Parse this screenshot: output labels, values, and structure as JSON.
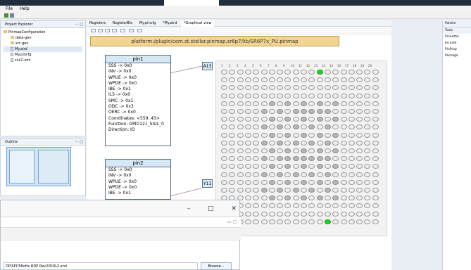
{
  "window": {
    "menu": [
      "File",
      "Help"
    ]
  },
  "left_panel": {
    "title": "Project Explorer",
    "tree": {
      "root": "PinmapConfiguration",
      "children": [
        "data-gen",
        "src-gen",
        "My.aird",
        "My.pincfg",
        "siul2.xml"
      ]
    }
  },
  "outline_panel": {
    "title": "Outline"
  },
  "editor": {
    "tabs": [
      "Registers",
      "RegisterBlo",
      "My.pincfg",
      "*My.aird",
      "*Graphical view"
    ],
    "path": "platform:/plugin/com.st.stellar.pinmap.sr6p7/lib/SR6P7x_PU.pinmap",
    "pins": [
      {
        "name": "pin1",
        "lines": [
          "SSS -> 0x0",
          "INV -> 0x0",
          "WPUE -> 0x0",
          "WPDE -> 0x0",
          "IBE -> 0x1",
          "ILS -> 0x0",
          "SMC -> 0x1",
          "ODC -> 0x3",
          "OERC -> 0x0",
          "Coordinates: <559, 43>",
          "Function: GPIO121_SIUL_0",
          "Direction: IO"
        ],
        "tag": "A13"
      },
      {
        "name": "pin2",
        "lines": [
          "SSS -> 0x0",
          "INV -> 0x0",
          "WPUE -> 0x0",
          "WPDE -> 0x0",
          "IBE -> 0x1"
        ],
        "tag": "Y11"
      }
    ],
    "grid_axis": [
      "1",
      "2",
      "3",
      "4",
      "5",
      "6",
      "7",
      "8",
      "9",
      "10",
      "11",
      "12",
      "13",
      "14",
      "15",
      "16",
      "17",
      "18",
      "19",
      "20"
    ]
  },
  "palette": {
    "title": "Palette",
    "tools_label": "Tools",
    "items": [
      "PinSettin",
      "Include",
      "PinProp",
      "Package"
    ]
  },
  "dialog": {
    "path_value": "DP\\SPC58xHx RDP Rev2\\SIUL2.xml",
    "browse_label": "Browse..."
  },
  "colors": {
    "accent_green": "#21d521",
    "pin_header": "#d6e8f4",
    "path_bar": "#f2d690"
  }
}
